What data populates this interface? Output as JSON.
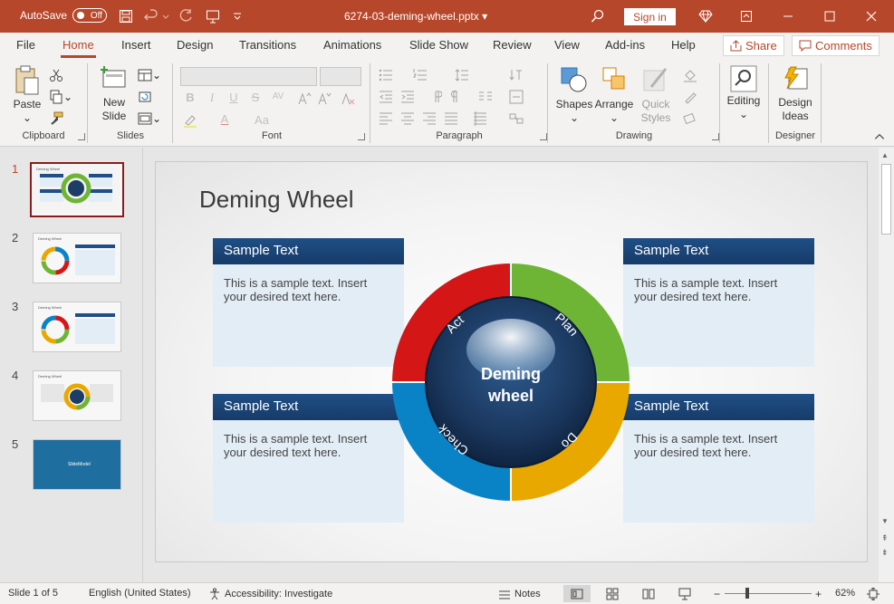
{
  "titlebar": {
    "autosave_label": "AutoSave",
    "autosave_state": "Off",
    "document_title": "6274-03-deming-wheel.pptx",
    "sign_in": "Sign in"
  },
  "tabs": [
    {
      "label": "File"
    },
    {
      "label": "Home"
    },
    {
      "label": "Insert"
    },
    {
      "label": "Design"
    },
    {
      "label": "Transitions"
    },
    {
      "label": "Animations"
    },
    {
      "label": "Slide Show"
    },
    {
      "label": "Review"
    },
    {
      "label": "View"
    },
    {
      "label": "Add-ins"
    },
    {
      "label": "Help"
    }
  ],
  "header_buttons": {
    "share": "Share",
    "comments": "Comments"
  },
  "ribbon": {
    "groups": {
      "clipboard": "Clipboard",
      "slides": "Slides",
      "font": "Font",
      "paragraph": "Paragraph",
      "drawing": "Drawing",
      "designer": "Designer"
    },
    "paste": "Paste",
    "new_slide_1": "New",
    "new_slide_2": "Slide",
    "shapes": "Shapes",
    "arrange": "Arrange",
    "quick_styles_1": "Quick",
    "quick_styles_2": "Styles",
    "editing": "Editing",
    "design_ideas_1": "Design",
    "design_ideas_2": "Ideas",
    "font_buttons": [
      "B",
      "I",
      "U",
      "S",
      "AV",
      "Aa",
      "A"
    ]
  },
  "thumbnails": [
    {
      "number": "1",
      "title": "Deming Wheel"
    },
    {
      "number": "2",
      "title": "Deming Wheel"
    },
    {
      "number": "3",
      "title": "Deming Wheel"
    },
    {
      "number": "4",
      "title": "Deming Wheel"
    },
    {
      "number": "5",
      "title": "SlideModel"
    }
  ],
  "slide": {
    "title": "Deming Wheel",
    "cards": [
      {
        "heading": "Sample Text",
        "body": "This is a sample text. Insert your desired text here."
      },
      {
        "heading": "Sample Text",
        "body": "This is a sample text. Insert your desired text here."
      },
      {
        "heading": "Sample Text",
        "body": "This is a sample text. Insert your desired text here."
      },
      {
        "heading": "Sample Text",
        "body": "This is a sample text. Insert your desired text here."
      }
    ],
    "wheel": {
      "center_line1": "Deming",
      "center_line2": "wheel",
      "segments": [
        {
          "label": "Plan",
          "color": "#6fb535"
        },
        {
          "label": "Do",
          "color": "#e9a800"
        },
        {
          "label": "Check",
          "color": "#0a83c6"
        },
        {
          "label": "Act",
          "color": "#d41616"
        }
      ]
    }
  },
  "status": {
    "slide_info": "Slide 1 of 5",
    "language": "English (United States)",
    "accessibility": "Accessibility: Investigate",
    "notes": "Notes",
    "zoom": "62%"
  },
  "colors": {
    "accent": "#b7472a",
    "card_header": "#1f4f86",
    "card_body": "#e2edf5"
  }
}
